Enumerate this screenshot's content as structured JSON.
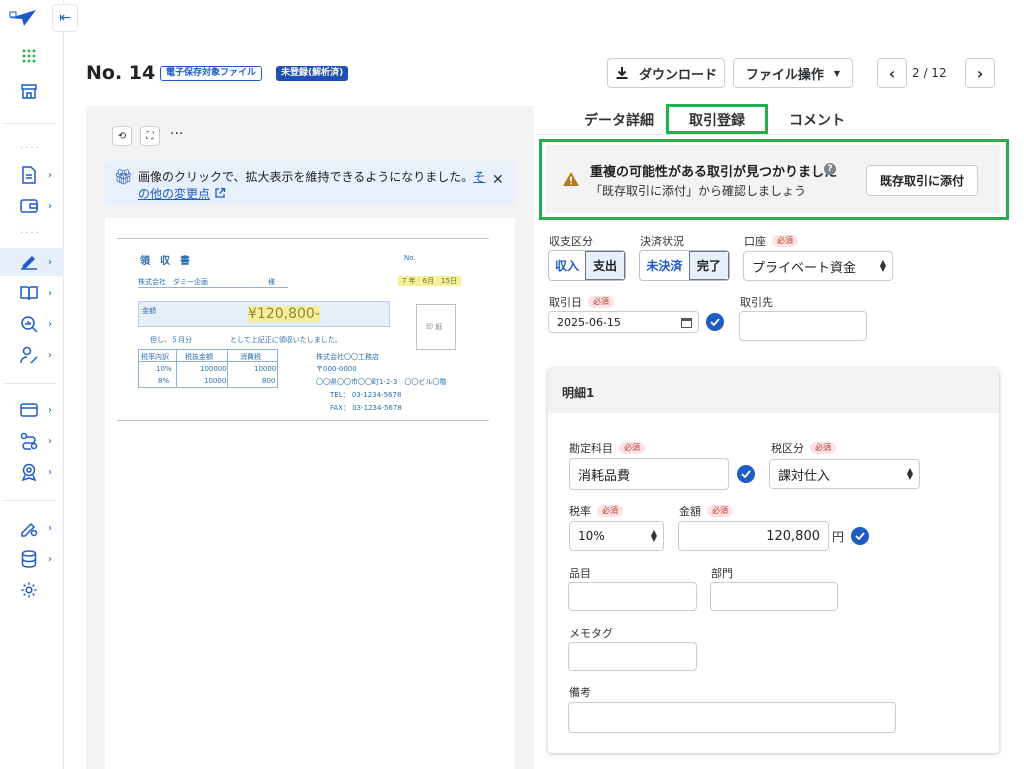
{
  "header": {
    "doc_number": "No. 14",
    "badge_storage": "電子保存対象ファイル",
    "badge_status": "未登録(解析済)",
    "download_label": "ダウンロード",
    "file_ops_label": "ファイル操作",
    "pager": "2 / 12"
  },
  "sidebar": {
    "items": [
      {
        "name": "apps-icon"
      },
      {
        "name": "store-icon"
      },
      {
        "name": "document-icon"
      },
      {
        "name": "wallet-icon"
      },
      {
        "name": "sign-icon"
      },
      {
        "name": "book-icon"
      },
      {
        "name": "search-report-icon"
      },
      {
        "name": "user-percent-icon"
      },
      {
        "name": "card-icon"
      },
      {
        "name": "route-icon"
      },
      {
        "name": "badge-icon"
      },
      {
        "name": "edit-settings-icon"
      },
      {
        "name": "database-icon"
      },
      {
        "name": "gear-icon"
      }
    ]
  },
  "preview": {
    "notice_text": "画像のクリックで、拡大表示を維持できるようになりました。",
    "notice_link": "その他の変更点",
    "receipt": {
      "title": "領　収　書",
      "no_label": "No.",
      "date": "7 年　6月　15日",
      "recipient": "株式会社　ダミー企画",
      "honorific": "様",
      "amount_label": "金額",
      "amount": "¥120,800-",
      "note_left": "但し、５月分",
      "note_right": "として上記正に領収いたしました。",
      "stamp": "印 紙",
      "table_headers": [
        "税率内訳",
        "税抜金額",
        "消費税"
      ],
      "table_rows": [
        [
          "10%",
          "100000",
          "10000"
        ],
        [
          "8%",
          "10000",
          "800"
        ]
      ],
      "issuer": "株式会社〇〇工務店",
      "postal": "〒000-0000",
      "address": "〇〇県〇〇市〇〇町1-2-3　〇〇ビル〇階",
      "tel": "TEL： 03-1234-5678",
      "fax": "FAX： 03-1234-5678"
    }
  },
  "tabs": [
    {
      "label": "データ詳細"
    },
    {
      "label": "取引登録"
    },
    {
      "label": "コメント"
    }
  ],
  "warning": {
    "title": "重複の可能性がある取引が見つかりました",
    "subtitle": "「既存取引に添付」から確認しましょう",
    "help": "?",
    "button": "既存取引に添付"
  },
  "form": {
    "required": "必須",
    "income_label": "収支区分",
    "income_options": [
      "収入",
      "支出"
    ],
    "settlement_label": "決済状況",
    "settlement_options": [
      "未決済",
      "完了"
    ],
    "account_label": "口座",
    "account_value": "プライベート資金",
    "date_label": "取引日",
    "date_value": "2025-06-15",
    "partner_label": "取引先",
    "detail": {
      "title": "明細1",
      "subject_label": "勘定科目",
      "subject_value": "消耗品費",
      "tax_class_label": "税区分",
      "tax_class_value": "課対仕入",
      "tax_rate_label": "税率",
      "tax_rate_value": "10%",
      "amount_label": "金額",
      "amount_value": "120,800",
      "amount_unit": "円",
      "item_label": "品目",
      "dept_label": "部門",
      "memo_label": "メモタグ",
      "remarks_label": "備考"
    }
  },
  "colors": {
    "accent": "#1d5cc7",
    "highlight_frame": "#1db34a",
    "warning": "#b7791f"
  }
}
